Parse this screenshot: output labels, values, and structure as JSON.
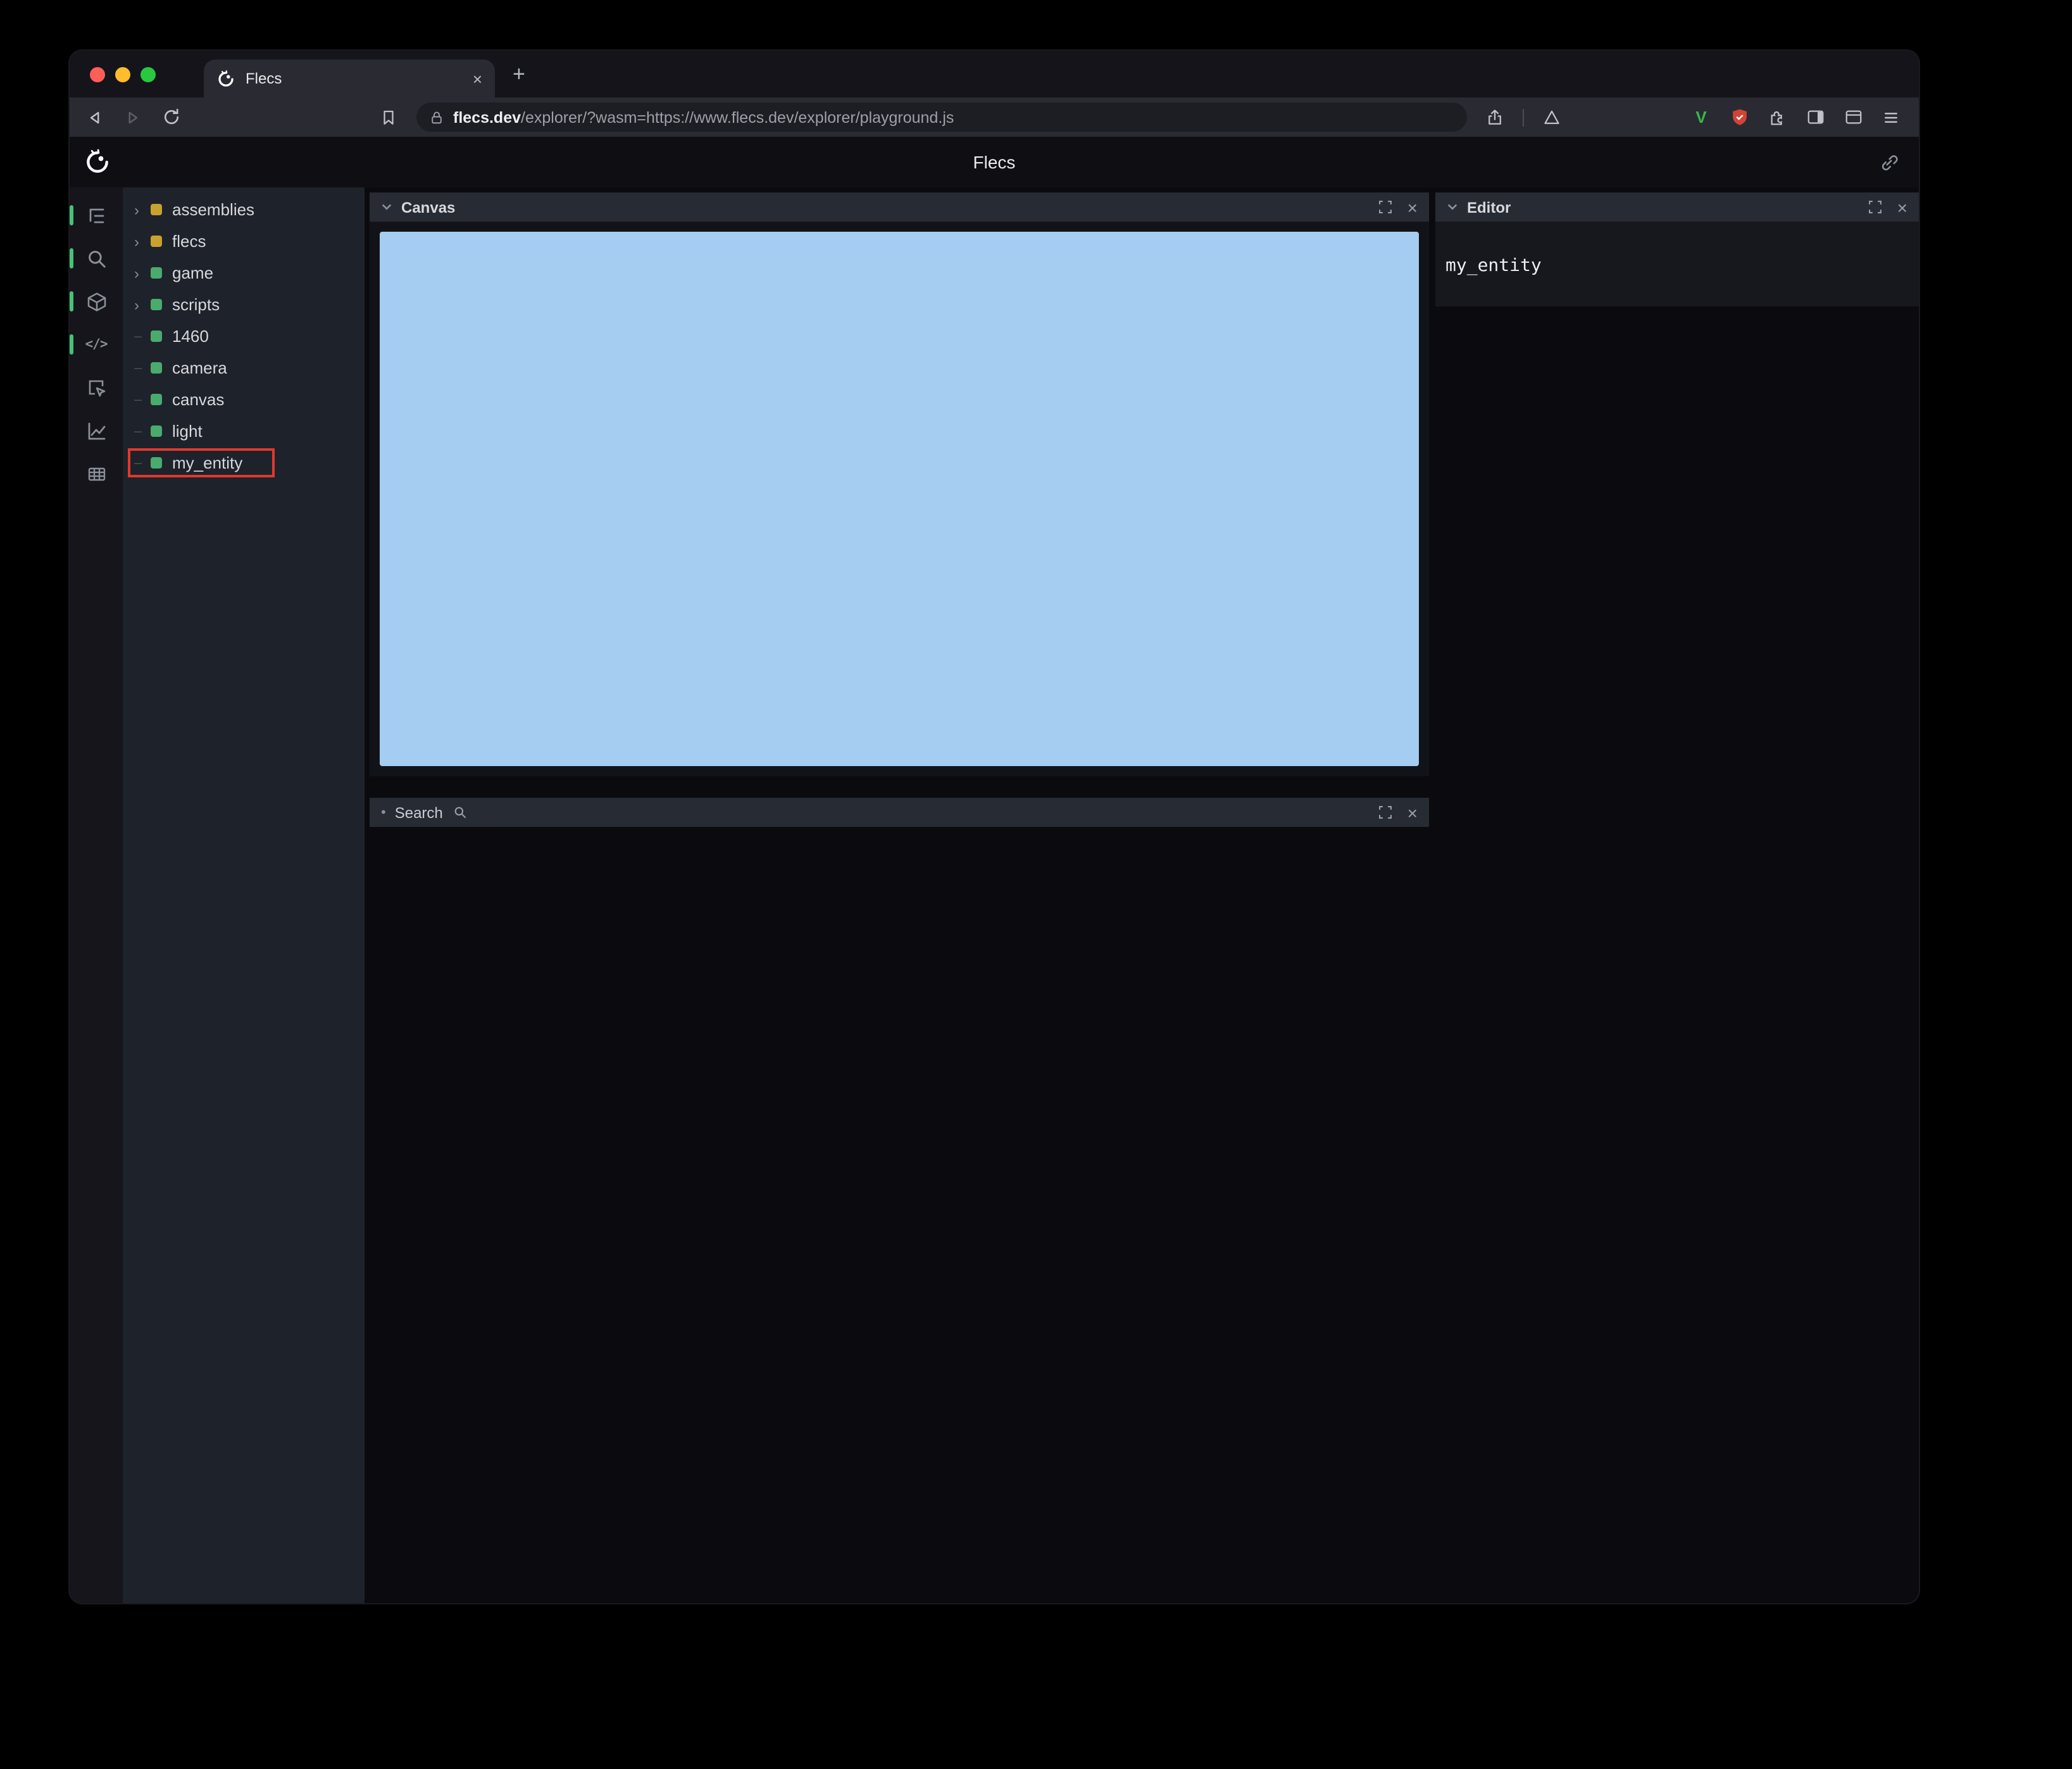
{
  "browser": {
    "tab_title": "Flecs",
    "url": {
      "domain": "flecs.dev",
      "rest": "/explorer/?wasm=https://www.flecs.dev/explorer/playground.js"
    }
  },
  "app": {
    "header": {
      "title": "Flecs"
    },
    "tree": {
      "items": [
        {
          "label": "assemblies",
          "color": "yellow",
          "expandable": true
        },
        {
          "label": "flecs",
          "color": "yellow",
          "expandable": true
        },
        {
          "label": "game",
          "color": "green",
          "expandable": true
        },
        {
          "label": "scripts",
          "color": "green",
          "expandable": true
        },
        {
          "label": "1460",
          "color": "green",
          "expandable": false
        },
        {
          "label": "camera",
          "color": "green",
          "expandable": false
        },
        {
          "label": "canvas",
          "color": "green",
          "expandable": false
        },
        {
          "label": "light",
          "color": "green",
          "expandable": false
        },
        {
          "label": "my_entity",
          "color": "green",
          "expandable": false,
          "highlighted": true
        }
      ]
    },
    "panels": {
      "canvas": {
        "title": "Canvas"
      },
      "search": {
        "title": "Search"
      },
      "editor": {
        "title": "Editor",
        "content": "my_entity"
      }
    }
  },
  "icons": {
    "close": "×",
    "chevron_right": "›",
    "leaf_dash": "–",
    "bullet": "•",
    "plus": "+",
    "code": "</>",
    "v_ext": "V"
  },
  "colors": {
    "traffic": [
      "#ff5f57",
      "#febc2e",
      "#28c840"
    ],
    "tree_square": {
      "yellow": "#c9a12f",
      "green": "#4aab6d"
    },
    "canvas_blue": "#a4cdf1",
    "annotation_red": "#e0392e",
    "accent_green": "#49c078"
  }
}
